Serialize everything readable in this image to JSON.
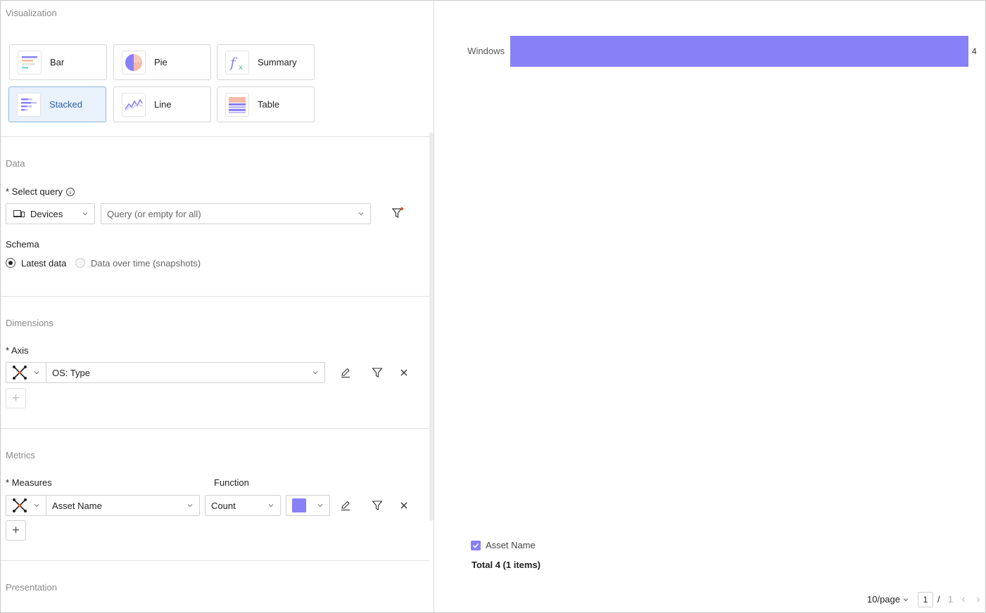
{
  "visualization": {
    "title": "Visualization",
    "types": [
      {
        "label": "Bar",
        "icon": "bar-chart-icon",
        "selected": false
      },
      {
        "label": "Pie",
        "icon": "pie-chart-icon",
        "selected": false
      },
      {
        "label": "Summary",
        "icon": "function-fx-icon",
        "selected": false
      },
      {
        "label": "Stacked",
        "icon": "stacked-chart-icon",
        "selected": true
      },
      {
        "label": "Line",
        "icon": "line-chart-icon",
        "selected": false
      },
      {
        "label": "Table",
        "icon": "table-icon",
        "selected": false
      }
    ]
  },
  "data": {
    "title": "Data",
    "select_query_label": "Select query",
    "required_mark": "*",
    "source_value": "Devices",
    "query_placeholder": "Query (or empty for all)",
    "schema_label": "Schema",
    "schema_options": [
      {
        "label": "Latest data",
        "checked": true,
        "disabled": false
      },
      {
        "label": "Data over time (snapshots)",
        "checked": false,
        "disabled": true
      }
    ]
  },
  "dimensions": {
    "title": "Dimensions",
    "axis_label": "Axis",
    "axis_value": "OS: Type",
    "add_label": "+"
  },
  "metrics": {
    "title": "Metrics",
    "measures_label": "Measures",
    "function_label": "Function",
    "measure_value": "Asset Name",
    "function_value": "Count",
    "color": "#8880f6",
    "add_label": "+"
  },
  "presentation": {
    "title": "Presentation"
  },
  "chart_data": {
    "type": "bar",
    "categories": [
      "Windows"
    ],
    "series": [
      {
        "name": "Asset Name",
        "values": [
          4
        ]
      }
    ],
    "xlim": [
      0,
      4
    ],
    "legend": "bottom-left",
    "grid": false
  },
  "legend": {
    "item_label": "Asset Name",
    "checked": true
  },
  "summary": {
    "total_text": "Total 4 (1 items)"
  },
  "pagination": {
    "page_size": "10/page",
    "current_page": "1",
    "separator": "/",
    "total_pages": "1"
  }
}
